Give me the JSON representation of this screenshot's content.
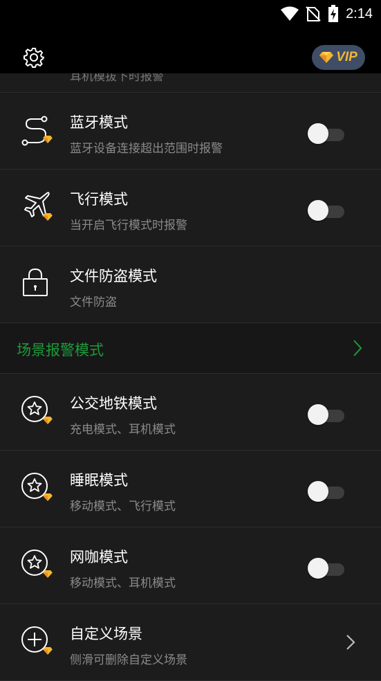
{
  "status_bar": {
    "time": "2:14",
    "icons": [
      "wifi-icon",
      "no-sim-icon",
      "battery-charging-icon"
    ]
  },
  "header": {
    "settings_icon": "gear-icon",
    "vip_label": "VIP",
    "vip_icon": "diamond-icon"
  },
  "list": {
    "partial_row_sub": "耳机模拔下时报警",
    "items": [
      {
        "title": "蓝牙模式",
        "sub": "蓝牙设备连接超出范围时报警",
        "icon": "bluetooth-route-icon",
        "vip": true,
        "control": "toggle",
        "on": false
      },
      {
        "title": "飞行模式",
        "sub": "当开启飞行模式时报警",
        "icon": "airplane-icon",
        "vip": true,
        "control": "toggle",
        "on": false
      },
      {
        "title": "文件防盗模式",
        "sub": "文件防盗",
        "icon": "lock-icon",
        "vip": false,
        "control": "none"
      }
    ],
    "section_title": "场景报警模式",
    "section_color": "#1e9b3c",
    "scenes": [
      {
        "title": "公交地铁模式",
        "sub": "充电模式、耳机模式",
        "icon": "star-icon",
        "vip": true,
        "control": "toggle",
        "on": false
      },
      {
        "title": "睡眠模式",
        "sub": "移动模式、飞行模式",
        "icon": "star-icon",
        "vip": true,
        "control": "toggle",
        "on": false
      },
      {
        "title": "网咖模式",
        "sub": "移动模式、耳机模式",
        "icon": "star-icon",
        "vip": true,
        "control": "toggle",
        "on": false
      },
      {
        "title": "自定义场景",
        "sub": "侧滑可删除自定义场景",
        "icon": "add-circle-icon",
        "vip": true,
        "control": "chevron"
      }
    ]
  },
  "colors": {
    "background": "#1c1c1c",
    "accent_green": "#1e9b3c",
    "vip_gold": "#f4b735",
    "vip_pill": "#3f4d67"
  }
}
